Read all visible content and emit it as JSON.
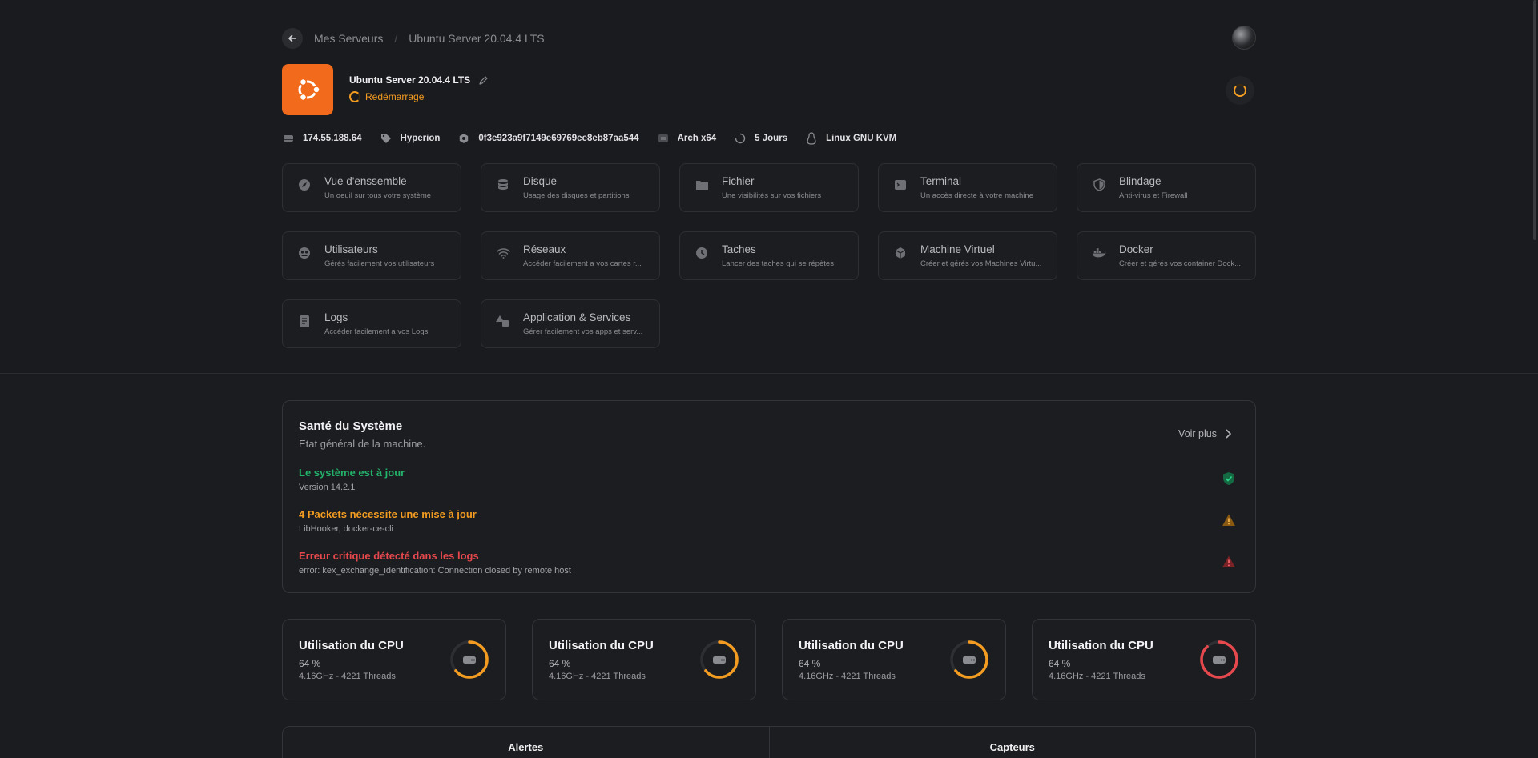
{
  "breadcrumb": {
    "parent": "Mes Serveurs",
    "separator": "/",
    "current": "Ubuntu Server 20.04.4 LTS"
  },
  "server": {
    "name": "Ubuntu Server 20.04.4 LTS",
    "status": "Redémarrage",
    "status_color": "#f39c21",
    "brand_color": "#f26a1b"
  },
  "meta": [
    {
      "icon": "server-icon",
      "value": "174.55.188.64"
    },
    {
      "icon": "tag-icon",
      "value": "Hyperion"
    },
    {
      "icon": "hexagon-icon",
      "value": "0f3e923a9f7149e69769ee8eb87aa544"
    },
    {
      "icon": "chip-icon",
      "value": "Arch x64"
    },
    {
      "icon": "uptime-icon",
      "value": "5 Jours"
    },
    {
      "icon": "linux-icon",
      "value": "Linux GNU KVM"
    }
  ],
  "nav": [
    {
      "icon": "compass-icon",
      "title": "Vue d'enssemble",
      "subtitle": "Un oeuil sur tous votre système"
    },
    {
      "icon": "database-icon",
      "title": "Disque",
      "subtitle": "Usage des disques et partitions"
    },
    {
      "icon": "folder-icon",
      "title": "Fichier",
      "subtitle": "Une visibilités sur vos fichiers"
    },
    {
      "icon": "terminal-icon",
      "title": "Terminal",
      "subtitle": "Un accès directe à votre machine"
    },
    {
      "icon": "shield-icon",
      "title": "Blindage",
      "subtitle": "Anti-virus et Firewall"
    },
    {
      "icon": "users-icon",
      "title": "Utilisateurs",
      "subtitle": "Gérés facilement vos utilisateurs"
    },
    {
      "icon": "wifi-icon",
      "title": "Réseaux",
      "subtitle": "Accéder facilement a vos cartes r..."
    },
    {
      "icon": "clock-icon",
      "title": "Taches",
      "subtitle": "Lancer des taches qui se répètes"
    },
    {
      "icon": "cube-icon",
      "title": "Machine Virtuel",
      "subtitle": "Créer et gérés vos Machines Virtu..."
    },
    {
      "icon": "docker-icon",
      "title": "Docker",
      "subtitle": "Créer et gérés vos container Dock..."
    },
    {
      "icon": "document-icon",
      "title": "Logs",
      "subtitle": "Accéder facilement a vos Logs"
    },
    {
      "icon": "shapes-icon",
      "title": "Application & Services",
      "subtitle": "Gérer facilement vos apps et serv..."
    }
  ],
  "health": {
    "title": "Santé du Système",
    "subtitle": "Etat général de la machine.",
    "more": "Voir plus",
    "items": [
      {
        "title": "Le système est à jour",
        "detail": "Version 14.2.1",
        "color": "#23b26b",
        "icon": "shield-check-icon"
      },
      {
        "title": "4 Packets nécessite une mise à jour",
        "detail": "LibHooker, docker-ce-cli",
        "color": "#f39c21",
        "icon": "warning-icon"
      },
      {
        "title": "Erreur critique détecté dans les logs",
        "detail": "error: kex_exchange_identification: Connection closed by remote host",
        "color": "#e5484d",
        "icon": "error-icon"
      }
    ]
  },
  "cpu": [
    {
      "title": "Utilisation du CPU",
      "value": "64 %",
      "detail": "4.16GHz - 4221 Threads",
      "fraction": 0.64,
      "color": "#f39c21"
    },
    {
      "title": "Utilisation du CPU",
      "value": "64 %",
      "detail": "4.16GHz - 4221 Threads",
      "fraction": 0.64,
      "color": "#f39c21"
    },
    {
      "title": "Utilisation du CPU",
      "value": "64 %",
      "detail": "4.16GHz - 4221 Threads",
      "fraction": 0.64,
      "color": "#f39c21"
    },
    {
      "title": "Utilisation du CPU",
      "value": "64 %",
      "detail": "4.16GHz - 4221 Threads",
      "fraction": 0.88,
      "color": "#e5484d"
    }
  ],
  "tabs": [
    "Alertes",
    "Capteurs"
  ]
}
